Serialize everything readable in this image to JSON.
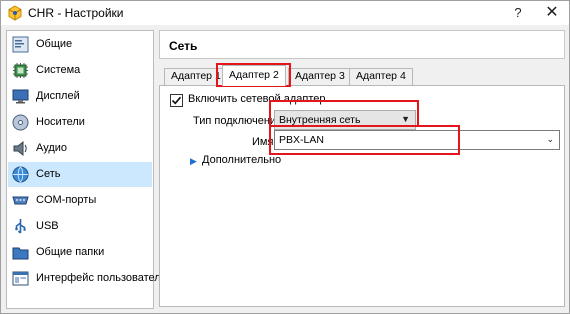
{
  "window": {
    "title": "CHR - Настройки",
    "help": "?",
    "close": "✕"
  },
  "sidebar": {
    "items": [
      {
        "label": "Общие",
        "icon": "general-icon"
      },
      {
        "label": "Система",
        "icon": "system-icon"
      },
      {
        "label": "Дисплей",
        "icon": "display-icon"
      },
      {
        "label": "Носители",
        "icon": "storage-icon"
      },
      {
        "label": "Аудио",
        "icon": "audio-icon"
      },
      {
        "label": "Сеть",
        "icon": "network-icon",
        "selected": true
      },
      {
        "label": "COM-порты",
        "icon": "serial-ports-icon"
      },
      {
        "label": "USB",
        "icon": "usb-icon"
      },
      {
        "label": "Общие папки",
        "icon": "shared-folders-icon"
      },
      {
        "label": "Интерфейс пользователя",
        "icon": "user-interface-icon"
      }
    ]
  },
  "header": {
    "title": "Сеть"
  },
  "tabs": [
    {
      "label": "Адаптер 1"
    },
    {
      "label": "Адаптер 2",
      "active": true
    },
    {
      "label": "Адаптер 3"
    },
    {
      "label": "Адаптер 4"
    }
  ],
  "adapter": {
    "enable_label": "Включить сетевой адаптер",
    "enabled": true,
    "attachment_label": "Тип подключения:",
    "attachment_value": "Внутренняя сеть",
    "name_label": "Имя",
    "name_value": "PBX-LAN",
    "advanced_label": "Дополнительно"
  },
  "colors": {
    "highlight": "#e4161b",
    "selection": "#cce8ff"
  }
}
